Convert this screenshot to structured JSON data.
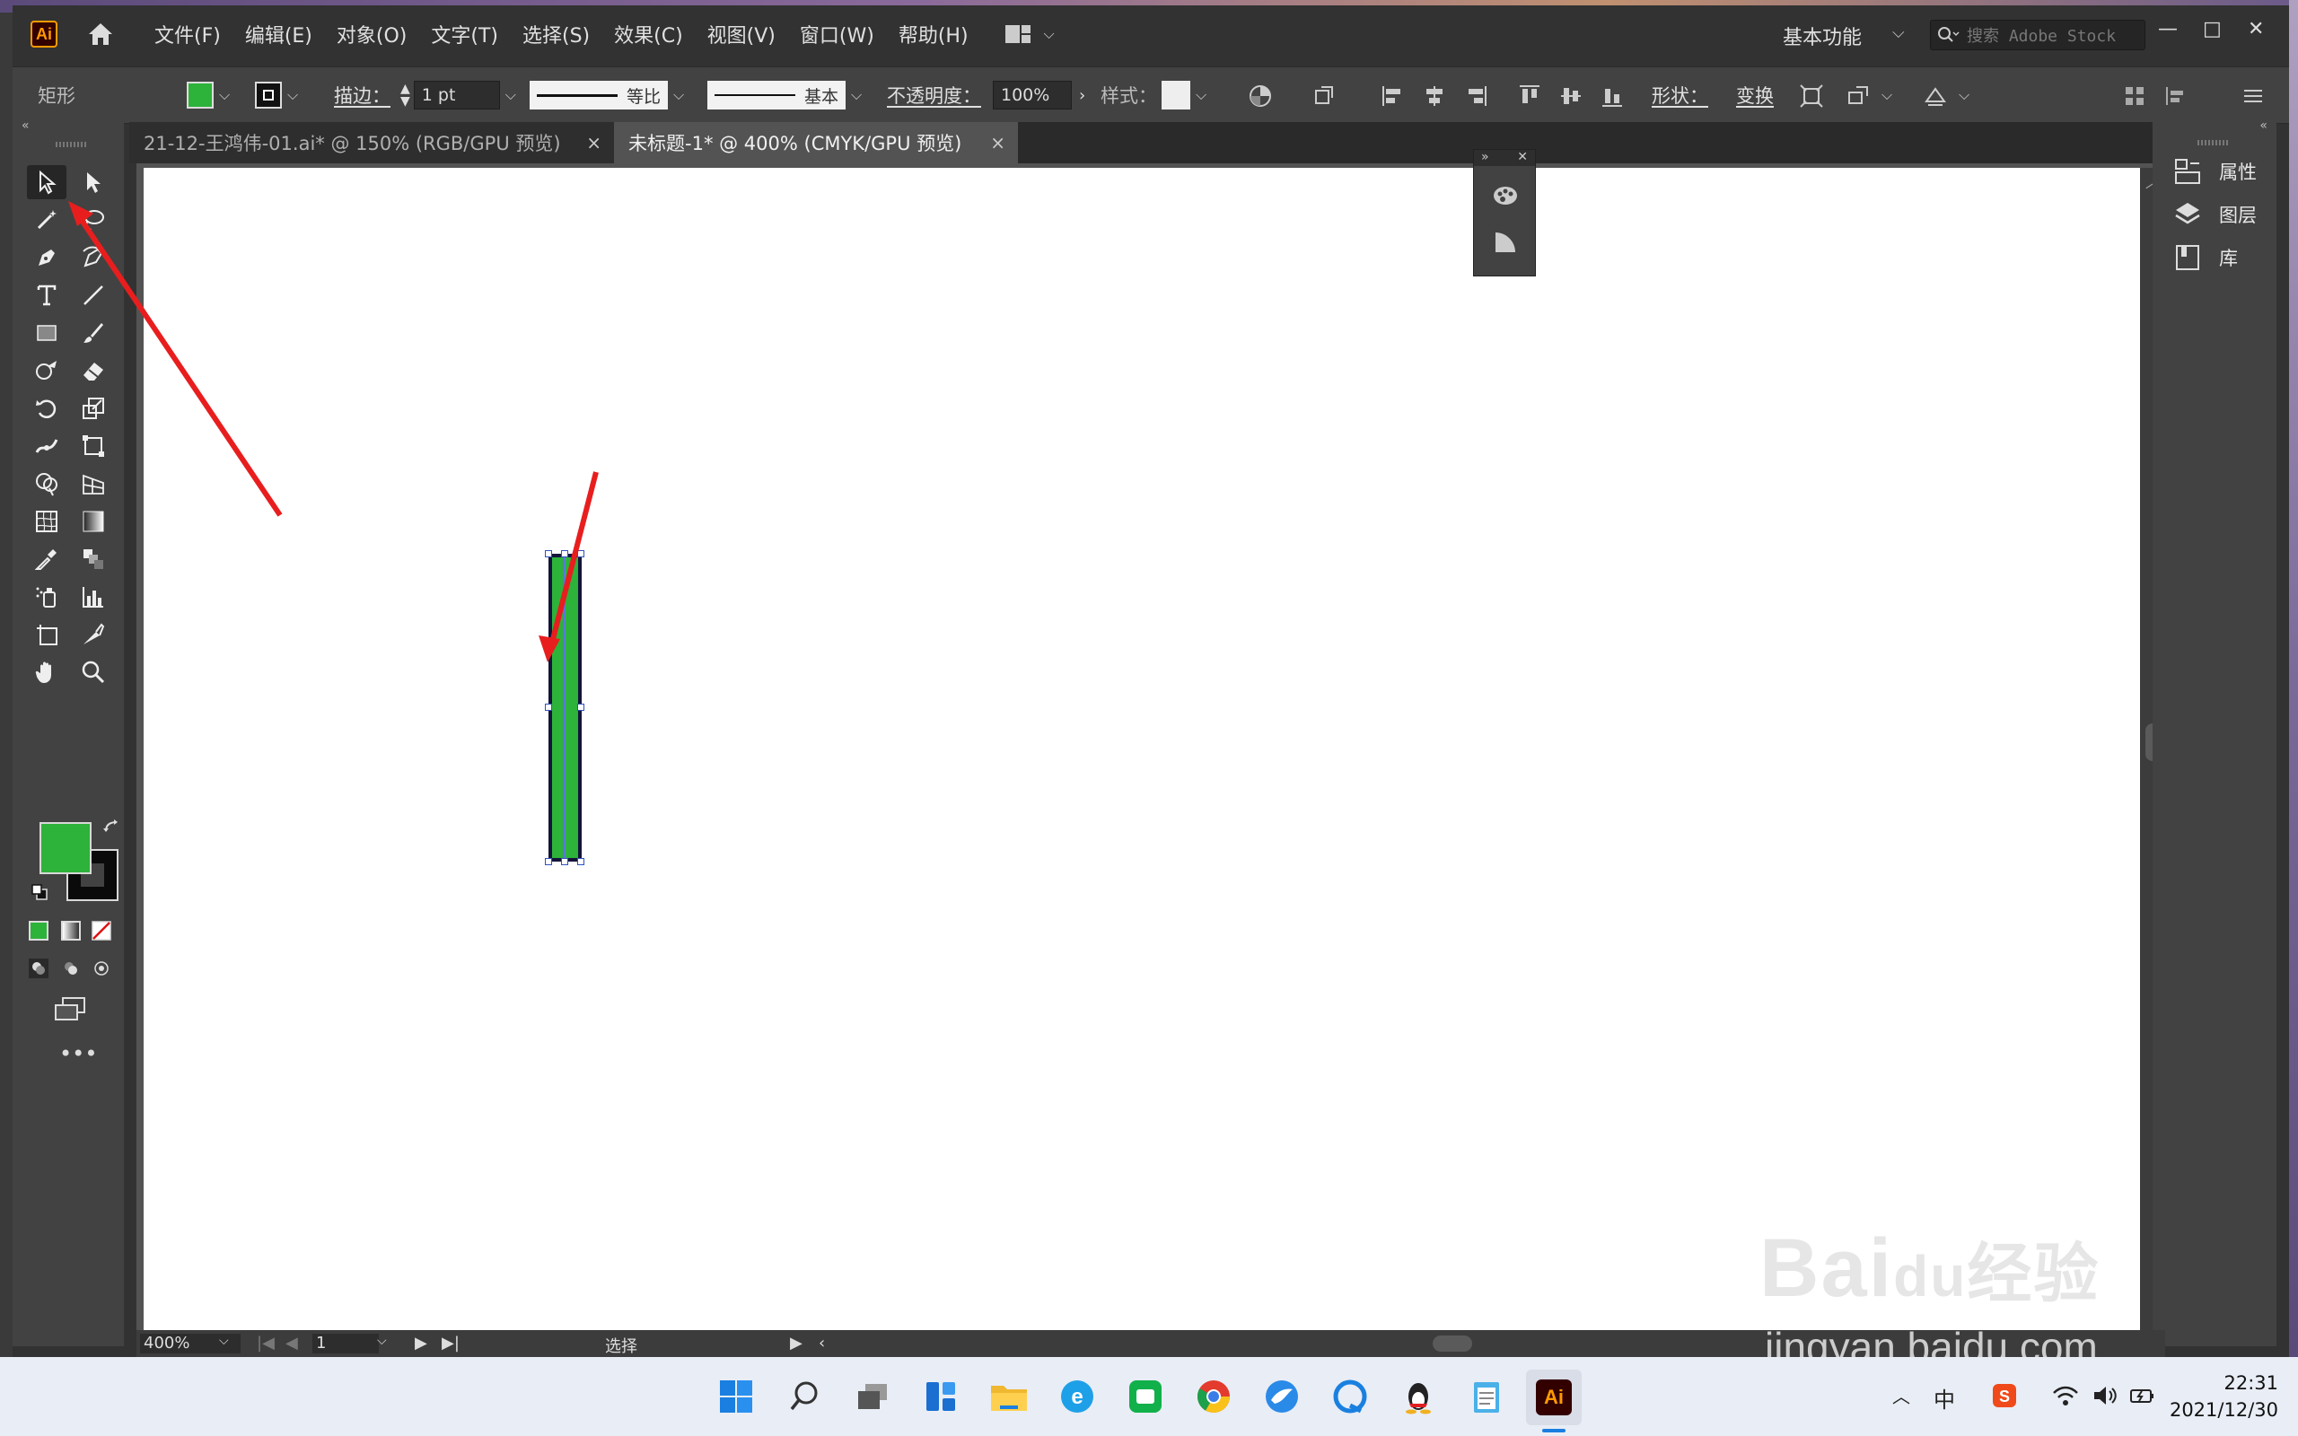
{
  "menubar": {
    "logo": "Ai",
    "items": [
      "文件(F)",
      "编辑(E)",
      "对象(O)",
      "文字(T)",
      "选择(S)",
      "效果(C)",
      "视图(V)",
      "窗口(W)",
      "帮助(H)"
    ],
    "workspace": "基本功能",
    "stock_placeholder": "搜索 Adobe Stock",
    "win_min": "—",
    "win_max": "□",
    "win_close": "✕"
  },
  "controlbar": {
    "object_type": "矩形",
    "stroke_label": "描边：",
    "stroke_weight": "1 pt",
    "stroke_profile": "等比",
    "brush": "基本",
    "opacity_label": "不透明度：",
    "opacity_value": "100%",
    "style_label": "样式：",
    "shape_label": "形状：",
    "transform_label": "变换"
  },
  "tabs": [
    {
      "label": "21-12-王鸿伟-01.ai* @ 150% (RGB/GPU 预览)",
      "close": "×"
    },
    {
      "label": "未标题-1* @ 400% (CMYK/GPU 预览)",
      "close": "×"
    }
  ],
  "right_dock": {
    "items": [
      "属性",
      "图层",
      "库"
    ]
  },
  "statusbar": {
    "zoom": "400%",
    "artboard": "1",
    "tool": "选择"
  },
  "colors": {
    "fill": "#2db23a",
    "stroke": "#0a0a0a",
    "accent": "#ff9a00"
  },
  "watermark": {
    "logo": "Bai",
    "logo2": "du",
    "logo3": "经验",
    "url": "jingyan.baidu.com"
  },
  "taskbar": {
    "ime": "中",
    "time": "22:31",
    "date": "2021/12/30",
    "app_label": "Ai"
  }
}
